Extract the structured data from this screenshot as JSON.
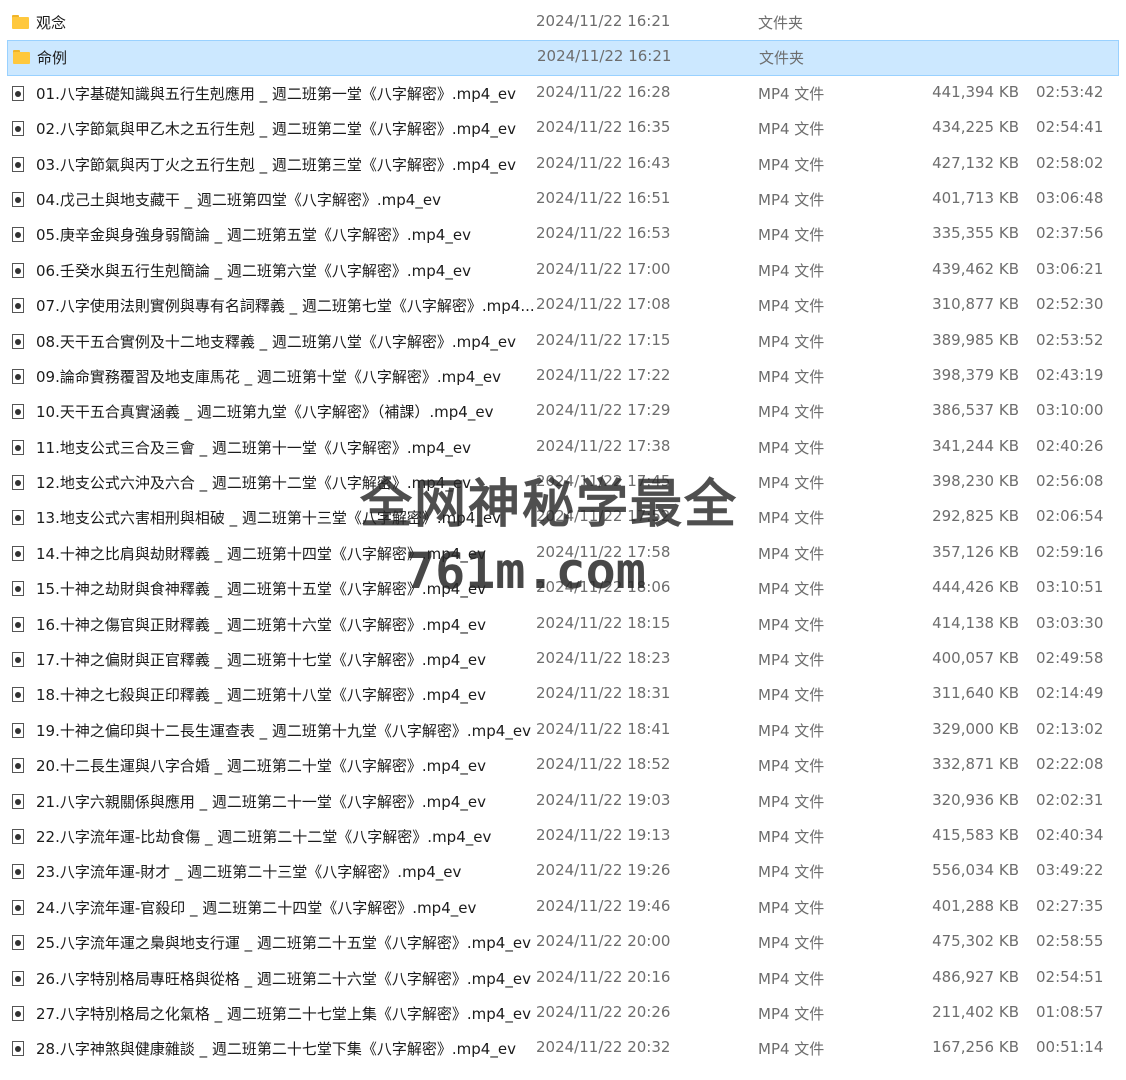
{
  "folders": [
    {
      "name": "观念",
      "date": "2024/11/22 16:21",
      "type": "文件夹",
      "selected": false
    },
    {
      "name": "命例",
      "date": "2024/11/22 16:21",
      "type": "文件夹",
      "selected": true
    }
  ],
  "files": [
    {
      "name": "01.八字基礎知識與五行生剋應用 _ 週二班第一堂《八字解密》.mp4_ev",
      "date": "2024/11/22 16:28",
      "type": "MP4 文件",
      "size": "441,394 KB",
      "duration": "02:53:42"
    },
    {
      "name": "02.八字節氣與甲乙木之五行生剋 _ 週二班第二堂《八字解密》.mp4_ev",
      "date": "2024/11/22 16:35",
      "type": "MP4 文件",
      "size": "434,225 KB",
      "duration": "02:54:41"
    },
    {
      "name": "03.八字節氣與丙丁火之五行生剋 _ 週二班第三堂《八字解密》.mp4_ev",
      "date": "2024/11/22 16:43",
      "type": "MP4 文件",
      "size": "427,132 KB",
      "duration": "02:58:02"
    },
    {
      "name": "04.戊己土與地支藏干 _ 週二班第四堂《八字解密》.mp4_ev",
      "date": "2024/11/22 16:51",
      "type": "MP4 文件",
      "size": "401,713 KB",
      "duration": "03:06:48"
    },
    {
      "name": "05.庚辛金與身強身弱簡論 _ 週二班第五堂《八字解密》.mp4_ev",
      "date": "2024/11/22 16:53",
      "type": "MP4 文件",
      "size": "335,355 KB",
      "duration": "02:37:56"
    },
    {
      "name": "06.壬癸水與五行生剋簡論 _ 週二班第六堂《八字解密》.mp4_ev",
      "date": "2024/11/22 17:00",
      "type": "MP4 文件",
      "size": "439,462 KB",
      "duration": "03:06:21"
    },
    {
      "name": "07.八字使用法則實例與專有名詞釋義 _ 週二班第七堂《八字解密》.mp4...",
      "date": "2024/11/22 17:08",
      "type": "MP4 文件",
      "size": "310,877 KB",
      "duration": "02:52:30"
    },
    {
      "name": "08.天干五合實例及十二地支釋義 _ 週二班第八堂《八字解密》.mp4_ev",
      "date": "2024/11/22 17:15",
      "type": "MP4 文件",
      "size": "389,985 KB",
      "duration": "02:53:52"
    },
    {
      "name": "09.論命實務覆習及地支庫馬花 _ 週二班第十堂《八字解密》.mp4_ev",
      "date": "2024/11/22 17:22",
      "type": "MP4 文件",
      "size": "398,379 KB",
      "duration": "02:43:19"
    },
    {
      "name": "10.天干五合真實涵義 _ 週二班第九堂《八字解密》（補課）.mp4_ev",
      "date": "2024/11/22 17:29",
      "type": "MP4 文件",
      "size": "386,537 KB",
      "duration": "03:10:00"
    },
    {
      "name": "11.地支公式三合及三會 _ 週二班第十一堂《八字解密》.mp4_ev",
      "date": "2024/11/22 17:38",
      "type": "MP4 文件",
      "size": "341,244 KB",
      "duration": "02:40:26"
    },
    {
      "name": "12.地支公式六沖及六合 _ 週二班第十二堂《八字解密》.mp4_ev",
      "date": "2024/11/22 17:45",
      "type": "MP4 文件",
      "size": "398,230 KB",
      "duration": "02:56:08"
    },
    {
      "name": "13.地支公式六害相刑與相破 _ 週二班第十三堂《八字解密》.mp4_ev",
      "date": "2024/11/22 17:52",
      "type": "MP4 文件",
      "size": "292,825 KB",
      "duration": "02:06:54"
    },
    {
      "name": "14.十神之比肩與劫財釋義 _ 週二班第十四堂《八字解密》.mp4_ev",
      "date": "2024/11/22 17:58",
      "type": "MP4 文件",
      "size": "357,126 KB",
      "duration": "02:59:16"
    },
    {
      "name": "15.十神之劫財與食神釋義 _ 週二班第十五堂《八字解密》.mp4_ev",
      "date": "2024/11/22 18:06",
      "type": "MP4 文件",
      "size": "444,426 KB",
      "duration": "03:10:51"
    },
    {
      "name": "16.十神之傷官與正財釋義 _ 週二班第十六堂《八字解密》.mp4_ev",
      "date": "2024/11/22 18:15",
      "type": "MP4 文件",
      "size": "414,138 KB",
      "duration": "03:03:30"
    },
    {
      "name": "17.十神之偏財與正官釋義 _ 週二班第十七堂《八字解密》.mp4_ev",
      "date": "2024/11/22 18:23",
      "type": "MP4 文件",
      "size": "400,057 KB",
      "duration": "02:49:58"
    },
    {
      "name": "18.十神之七殺與正印釋義 _ 週二班第十八堂《八字解密》.mp4_ev",
      "date": "2024/11/22 18:31",
      "type": "MP4 文件",
      "size": "311,640 KB",
      "duration": "02:14:49"
    },
    {
      "name": "19.十神之偏印與十二長生運查表 _ 週二班第十九堂《八字解密》.mp4_ev",
      "date": "2024/11/22 18:41",
      "type": "MP4 文件",
      "size": "329,000 KB",
      "duration": "02:13:02"
    },
    {
      "name": "20.十二長生運與八字合婚 _ 週二班第二十堂《八字解密》.mp4_ev",
      "date": "2024/11/22 18:52",
      "type": "MP4 文件",
      "size": "332,871 KB",
      "duration": "02:22:08"
    },
    {
      "name": "21.八字六親關係與應用 _ 週二班第二十一堂《八字解密》.mp4_ev",
      "date": "2024/11/22 19:03",
      "type": "MP4 文件",
      "size": "320,936 KB",
      "duration": "02:02:31"
    },
    {
      "name": "22.八字流年運-比劫食傷 _ 週二班第二十二堂《八字解密》.mp4_ev",
      "date": "2024/11/22 19:13",
      "type": "MP4 文件",
      "size": "415,583 KB",
      "duration": "02:40:34"
    },
    {
      "name": "23.八字流年運-財才 _ 週二班第二十三堂《八字解密》.mp4_ev",
      "date": "2024/11/22 19:26",
      "type": "MP4 文件",
      "size": "556,034 KB",
      "duration": "03:49:22"
    },
    {
      "name": "24.八字流年運-官殺印 _ 週二班第二十四堂《八字解密》.mp4_ev",
      "date": "2024/11/22 19:46",
      "type": "MP4 文件",
      "size": "401,288 KB",
      "duration": "02:27:35"
    },
    {
      "name": "25.八字流年運之梟與地支行運 _ 週二班第二十五堂《八字解密》.mp4_ev",
      "date": "2024/11/22 20:00",
      "type": "MP4 文件",
      "size": "475,302 KB",
      "duration": "02:58:55"
    },
    {
      "name": "26.八字特別格局專旺格與從格 _ 週二班第二十六堂《八字解密》.mp4_ev",
      "date": "2024/11/22 20:16",
      "type": "MP4 文件",
      "size": "486,927 KB",
      "duration": "02:54:51"
    },
    {
      "name": "27.八字特別格局之化氣格 _ 週二班第二十七堂上集《八字解密》.mp4_ev",
      "date": "2024/11/22 20:26",
      "type": "MP4 文件",
      "size": "211,402 KB",
      "duration": "01:08:57"
    },
    {
      "name": "28.八字神煞與健康雜談 _ 週二班第二十七堂下集《八字解密》.mp4_ev",
      "date": "2024/11/22 20:32",
      "type": "MP4 文件",
      "size": "167,256 KB",
      "duration": "00:51:14"
    }
  ],
  "watermark": {
    "line1": "全网神秘学最全",
    "line2": "761m.com"
  },
  "colors": {
    "selection_bg": "#cce8ff",
    "selection_border": "#99d1ff",
    "folder": "#ffc83d",
    "secondary_text": "#6d6d6d"
  }
}
